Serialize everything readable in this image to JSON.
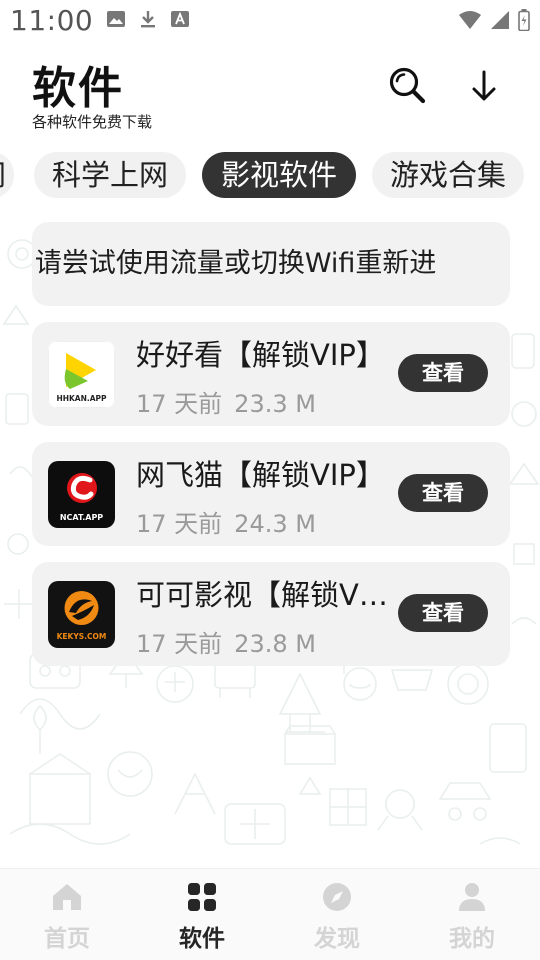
{
  "status_bar": {
    "time": "11:00",
    "left_icons": [
      "image-icon",
      "download-icon",
      "text-a-icon"
    ],
    "right_icons": [
      "wifi-icon",
      "signal-icon",
      "battery-icon"
    ]
  },
  "header": {
    "title": "软件",
    "subtitle": "各种软件免费下载",
    "search_icon": "search-icon",
    "download_icon": "arrow-down-icon"
  },
  "tabs": [
    {
      "label": "网",
      "active": false
    },
    {
      "label": "科学上网",
      "active": false
    },
    {
      "label": "影视软件",
      "active": true
    },
    {
      "label": "游戏合集",
      "active": false
    }
  ],
  "notice": {
    "text": "!请尝试使用流量或切换Wifi重新进"
  },
  "apps": [
    {
      "name": "好好看【解锁VIP】",
      "time": "17 天前",
      "size": "23.3 M",
      "button": "查看",
      "icon_text": "HHKAN.APP"
    },
    {
      "name": "网飞猫【解锁VIP】",
      "time": "17 天前",
      "size": "24.3 M",
      "button": "查看",
      "icon_text": "NCAT.APP"
    },
    {
      "name": "可可影视【解锁VIP】",
      "time": "17 天前",
      "size": "23.8 M",
      "button": "查看",
      "icon_text": "KEKYS.COM"
    }
  ],
  "nav": [
    {
      "label": "首页",
      "icon": "home-icon",
      "active": false
    },
    {
      "label": "软件",
      "icon": "apps-grid-icon",
      "active": true
    },
    {
      "label": "发现",
      "icon": "compass-icon",
      "active": false
    },
    {
      "label": "我的",
      "icon": "user-icon",
      "active": false
    }
  ],
  "colors": {
    "accent_dark": "#333333",
    "card_bg": "#f2f2f2",
    "muted_text": "#9a9a9a",
    "nav_inactive": "#d4d4d4"
  }
}
